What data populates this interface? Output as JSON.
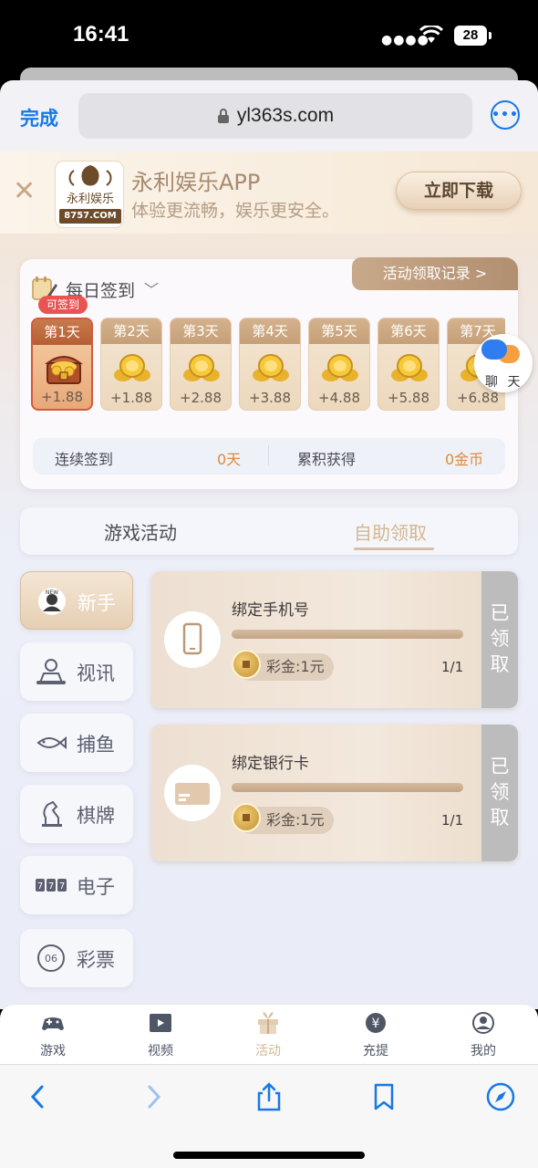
{
  "status_bar": {
    "time": "16:41",
    "battery": "28"
  },
  "browser": {
    "done_label": "完成",
    "url": "yl363s.com"
  },
  "banner": {
    "logo_line1": "永利娱乐",
    "logo_domain": "8757.COM",
    "app_name": "永利娱乐APP",
    "subtitle": "体验更流畅，娱乐更安全。",
    "download_label": "立即下载"
  },
  "signin": {
    "title": "每日签到",
    "records_label": "活动领取记录 >",
    "can_sign_badge": "可签到",
    "days": [
      {
        "label": "第1天",
        "value": "+1.88",
        "icon": "treasure-chest-icon"
      },
      {
        "label": "第2天",
        "value": "+1.88",
        "icon": "gold-coins-icon"
      },
      {
        "label": "第3天",
        "value": "+2.88",
        "icon": "gold-coins-icon"
      },
      {
        "label": "第4天",
        "value": "+3.88",
        "icon": "gold-coins-icon"
      },
      {
        "label": "第5天",
        "value": "+4.88",
        "icon": "gold-coins-icon"
      },
      {
        "label": "第6天",
        "value": "+5.88",
        "icon": "gold-coins-icon"
      },
      {
        "label": "第7天",
        "value": "+6.88",
        "icon": "gold-coins-icon"
      }
    ],
    "consecutive_label": "连续签到",
    "consecutive_value": "0天",
    "total_label": "累积获得",
    "total_value": "0金币",
    "accent_color": "#e08a3c"
  },
  "chat": {
    "label": "聊天"
  },
  "tabs": [
    {
      "label": "游戏活动",
      "active": false
    },
    {
      "label": "自助领取",
      "active": true
    }
  ],
  "sidebar": [
    {
      "label": "新手",
      "icon": "new-user-icon",
      "active": true
    },
    {
      "label": "视讯",
      "icon": "live-dealer-icon",
      "active": false
    },
    {
      "label": "捕鱼",
      "icon": "fish-icon",
      "active": false
    },
    {
      "label": "棋牌",
      "icon": "chess-knight-icon",
      "active": false
    },
    {
      "label": "电子",
      "icon": "slot-777-icon",
      "active": false
    },
    {
      "label": "彩票",
      "icon": "lottery-ball-icon",
      "active": false
    }
  ],
  "tasks": [
    {
      "name": "绑定手机号",
      "reward": "彩金:1元",
      "progress_text": "1/1",
      "progress": 1.0,
      "status": "已领取",
      "icon": "phone-icon"
    },
    {
      "name": "绑定银行卡",
      "reward": "彩金:1元",
      "progress_text": "1/1",
      "progress": 1.0,
      "status": "已领取",
      "icon": "bank-card-icon"
    }
  ],
  "bottom_nav": [
    {
      "label": "游戏",
      "icon": "gamepad-icon",
      "active": false
    },
    {
      "label": "视频",
      "icon": "video-icon",
      "active": false
    },
    {
      "label": "活动",
      "icon": "gift-icon",
      "active": true
    },
    {
      "label": "充提",
      "icon": "yen-icon",
      "active": false
    },
    {
      "label": "我的",
      "icon": "profile-icon",
      "active": false
    }
  ],
  "toolbar": [
    "back-icon",
    "forward-icon",
    "share-icon",
    "bookmarks-icon",
    "compass-icon"
  ],
  "colors": {
    "ios_blue": "#1778e7",
    "gold": "#c4a584",
    "claimed_gray": "#bcbcbc"
  }
}
